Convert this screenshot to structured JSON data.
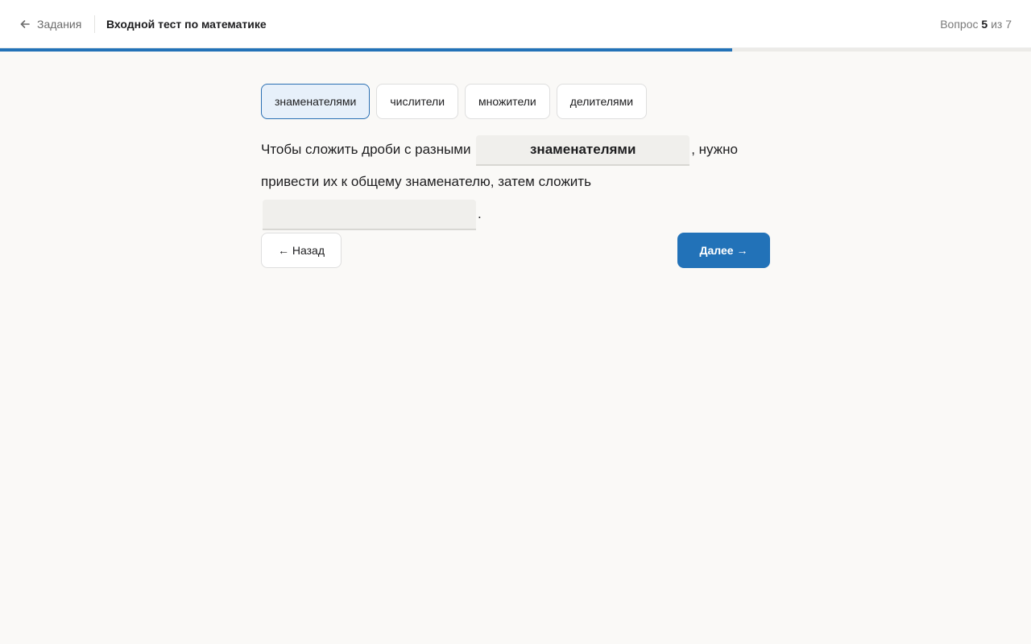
{
  "header": {
    "back_label": "Задания",
    "title": "Входной тест по математике",
    "counter_prefix": "Вопрос",
    "counter_current": "5",
    "counter_separator": "из",
    "counter_total": "7"
  },
  "progress": {
    "fraction": 0.71
  },
  "word_bank": [
    {
      "label": "знаменателями",
      "selected": true
    },
    {
      "label": "числители",
      "selected": false
    },
    {
      "label": "множители",
      "selected": false
    },
    {
      "label": "делителями",
      "selected": false
    }
  ],
  "question": {
    "text_1": "Чтобы сложить дроби с разными",
    "blank_1_value": "знаменателями",
    "text_2": ", нужно привести их к общему знаменателю, затем сложить",
    "blank_2_value": "",
    "text_3": "."
  },
  "nav": {
    "back_label": "← Назад",
    "next_label": "Далее →"
  },
  "colors": {
    "accent": "#2272b8",
    "selected_chip_bg": "#e7f0fa"
  },
  "icons": {
    "back": "arrow-left-icon"
  }
}
